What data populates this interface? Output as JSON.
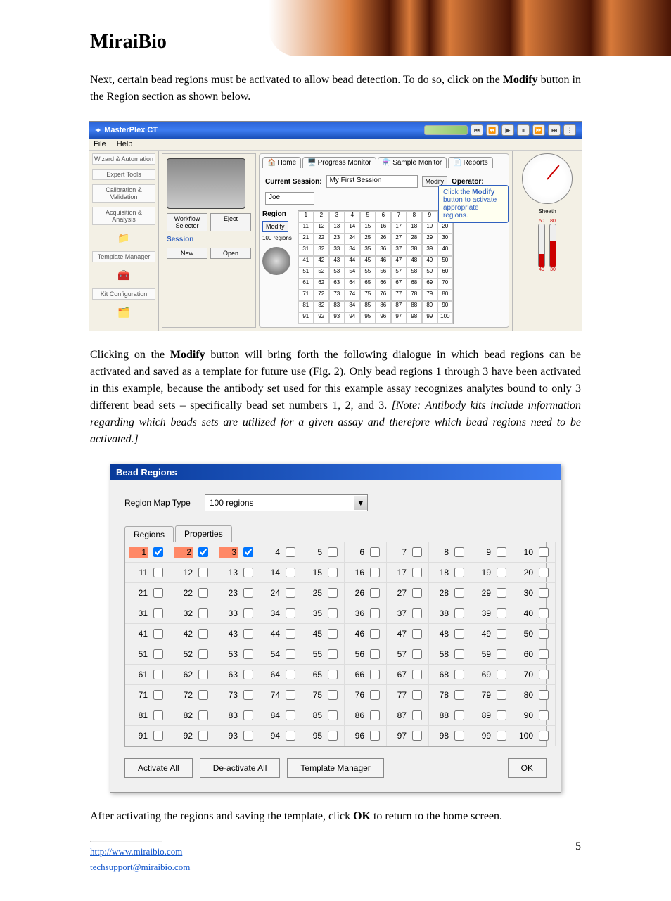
{
  "logo": "MiraiBio",
  "paragraph1": "Next, certain bead regions must be activated to allow bead detection. To do so, click on the ",
  "paragraph1_btn": "Modify",
  "paragraph1_end": " button in the Region section as shown below.",
  "paragraph2_a": "Clicking on the ",
  "paragraph2_btn": "Modify",
  "paragraph2_b": " button will bring forth the following dialogue in which bead regions can be activated and saved as a template for future use (Fig. 2). Only bead regions 1 through 3 have been activated in this example, because the antibody set used for this example assay recognizes analytes bound to only 3 different bead sets – specifically bead set numbers 1, 2, and 3.",
  "paragraph2_note_prefix": "[Note:",
  "paragraph2_note": " Antibody kits include information regarding which beads sets are utilized for a given assay and therefore which bead regions need to be activated.]",
  "paragraph3": "After activating the regions and saving the template, click ",
  "paragraph3_btn": "OK",
  "paragraph3_end": " to return to the home screen.",
  "app": {
    "title": "MasterPlex CT",
    "menu": {
      "file": "File",
      "help": "Help"
    },
    "sidebar": {
      "wizard": "Wizard & Automation",
      "expert": "Expert Tools",
      "calib": "Calibration & Validation",
      "acq": "Acquisition & Analysis",
      "template": "Template Manager",
      "kit": "Kit Configuration"
    },
    "tabs": {
      "home": "Home",
      "progress": "Progress Monitor",
      "sample": "Sample Monitor",
      "reports": "Reports"
    },
    "session_label": "Current Session:",
    "session_value": "My First Session",
    "modify_btn": "Modify",
    "operator_label": "Operator:",
    "operator_value": "Joe",
    "region_label": "Region",
    "region_map": "100 regions",
    "workflow": "Workflow Selector",
    "eject": "Eject",
    "session_hdr": "Session",
    "new": "New",
    "open": "Open",
    "tooltip_a": "Click the ",
    "tooltip_b": "Modify",
    "tooltip_c": " button to activate appropriate regions.",
    "sheath": "Sheath"
  },
  "dialog": {
    "title": "Bead Regions",
    "map_type_label": "Region Map Type",
    "map_type_value": "100 regions",
    "tab_regions": "Regions",
    "tab_props": "Properties",
    "activate_all": "Activate All",
    "deactivate_all": "De-activate All",
    "template_mgr": "Template Manager",
    "ok": "OK",
    "active": [
      1,
      2,
      3
    ],
    "total": 100
  },
  "footer": {
    "url": "http://www.miraibio.com",
    "email": "techsupport@miraibio.com",
    "page": "5"
  }
}
